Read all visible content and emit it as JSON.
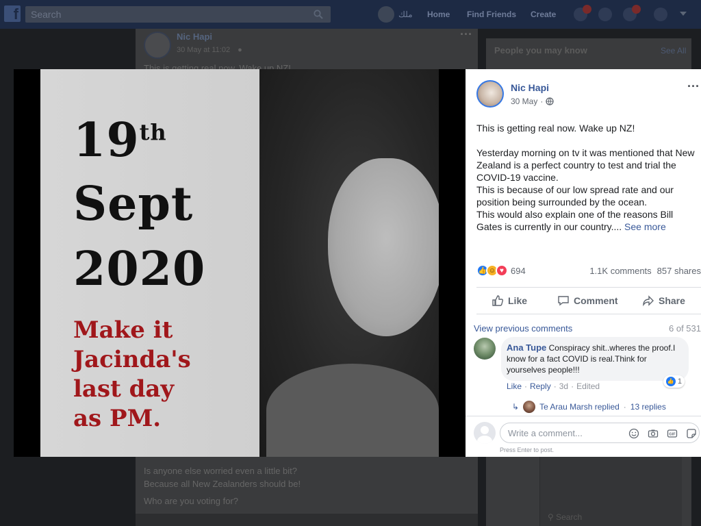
{
  "topbar": {
    "logo": "f",
    "search_placeholder": "Search",
    "user_short": "ملك",
    "home": "Home",
    "find_friends": "Find Friends",
    "create": "Create"
  },
  "background_feed": {
    "author": "Nic Hapi",
    "time": "30 May at 11:02",
    "line1": "This is getting real now. Wake up NZ!",
    "line2": "Is anyone else worried even a little bit?",
    "line3": "Because all New Zealanders should be!",
    "line4": "Who are you voting for?",
    "people_you_may_know": "People you may know",
    "see_all": "See All",
    "search_small": "Search"
  },
  "photo": {
    "date_day": "19",
    "date_suffix": "th",
    "date_month": "Sept",
    "date_year": "2020",
    "msg_line1": "Make it",
    "msg_line2": "Jacinda's",
    "msg_line3": "last day",
    "msg_line4": "as PM."
  },
  "post": {
    "author": "Nic Hapi",
    "date": "30 May",
    "paragraph1": "This is getting real now. Wake up NZ!",
    "paragraph2_l1": "Yesterday morning on tv it was mentioned that New Zealand is a perfect country to test and trial the COVID-19 vaccine.",
    "paragraph2_l2": "This is because of our low spread rate and our position being surrounded by the ocean.",
    "paragraph2_l3": "This would also explain one of the reasons Bill Gates is currently in our country....",
    "see_more": "See more",
    "reaction_count": "694",
    "comments_count": "1.1K comments",
    "shares_count": "857 shares"
  },
  "actions": {
    "like": "Like",
    "comment": "Comment",
    "share": "Share"
  },
  "comments": {
    "view_previous": "View previous comments",
    "position": "6 of 531",
    "item": {
      "author": "Ana Tupe",
      "text": "Conspiracy shit..wheres the proof.I know for a fact COVID is real.Think for yourselves people!!!",
      "reaction_count": "1",
      "like": "Like",
      "reply": "Reply",
      "age": "3d",
      "edited": "Edited"
    },
    "reply_summary": {
      "arrow": "↳",
      "author_replied": "Te Arau Marsh replied",
      "sep": "·",
      "replies": "13 replies"
    }
  },
  "composer": {
    "placeholder": "Write a comment...",
    "hint": "Press Enter to post."
  },
  "colors": {
    "facebook_blue": "#385898",
    "topbar": "#1d2a44",
    "photo_text_red": "#a0171b"
  }
}
